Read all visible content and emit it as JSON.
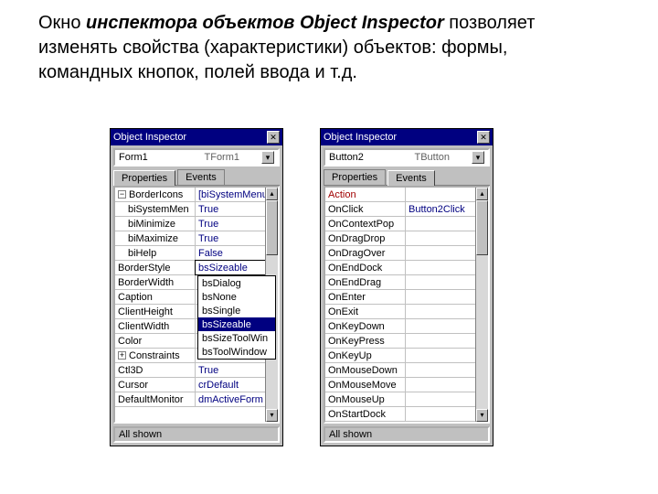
{
  "caption": {
    "part1": "Окно ",
    "em1": "инспектора объектов",
    "mid": " ",
    "em2": "Object Inspector",
    "rest": " позволяет изменять свойства (характеристики) объектов: формы, командных кнопок, полей ввода и т.д."
  },
  "chart_data": {
    "type": "table"
  },
  "left": {
    "title": "Object Inspector",
    "close": "✕",
    "instance": "Form1",
    "type": "TForm1",
    "dd": "▾",
    "tabs": {
      "props": "Properties",
      "events": "Events",
      "active": "props"
    },
    "rows": [
      {
        "k": "BorderIcons",
        "v": "[biSystemMenu,",
        "exp": "−"
      },
      {
        "k": "biSystemMen",
        "v": "True",
        "indent": true
      },
      {
        "k": "biMinimize",
        "v": "True",
        "indent": true
      },
      {
        "k": "biMaximize",
        "v": "True",
        "indent": true
      },
      {
        "k": "biHelp",
        "v": "False",
        "indent": true
      },
      {
        "k": "BorderStyle",
        "v": "bsSizeable",
        "editing": true
      },
      {
        "k": "BorderWidth",
        "v": ""
      },
      {
        "k": "Caption",
        "v": ""
      },
      {
        "k": "ClientHeight",
        "v": ""
      },
      {
        "k": "ClientWidth",
        "v": ""
      },
      {
        "k": "Color",
        "v": ""
      },
      {
        "k": "Constraints",
        "v": "",
        "exp": "+"
      },
      {
        "k": "Ctl3D",
        "v": "True"
      },
      {
        "k": "Cursor",
        "v": "crDefault"
      },
      {
        "k": "DefaultMonitor",
        "v": "dmActiveForm"
      }
    ],
    "dropdown": {
      "after_row": 5,
      "options": [
        "bsDialog",
        "bsNone",
        "bsSingle",
        "bsSizeable",
        "bsSizeToolWin",
        "bsToolWindow"
      ],
      "selected": "bsSizeable"
    },
    "status": "All shown"
  },
  "right": {
    "title": "Object Inspector",
    "close": "✕",
    "instance": "Button2",
    "type": "TButton",
    "dd": "▾",
    "tabs": {
      "props": "Properties",
      "events": "Events",
      "active": "events"
    },
    "rows": [
      {
        "k": "Action",
        "v": "",
        "red": true
      },
      {
        "k": "OnClick",
        "v": "Button2Click"
      },
      {
        "k": "OnContextPop",
        "v": ""
      },
      {
        "k": "OnDragDrop",
        "v": ""
      },
      {
        "k": "OnDragOver",
        "v": ""
      },
      {
        "k": "OnEndDock",
        "v": ""
      },
      {
        "k": "OnEndDrag",
        "v": ""
      },
      {
        "k": "OnEnter",
        "v": ""
      },
      {
        "k": "OnExit",
        "v": ""
      },
      {
        "k": "OnKeyDown",
        "v": ""
      },
      {
        "k": "OnKeyPress",
        "v": ""
      },
      {
        "k": "OnKeyUp",
        "v": ""
      },
      {
        "k": "OnMouseDown",
        "v": ""
      },
      {
        "k": "OnMouseMove",
        "v": ""
      },
      {
        "k": "OnMouseUp",
        "v": ""
      },
      {
        "k": "OnStartDock",
        "v": ""
      }
    ],
    "status": "All shown"
  }
}
